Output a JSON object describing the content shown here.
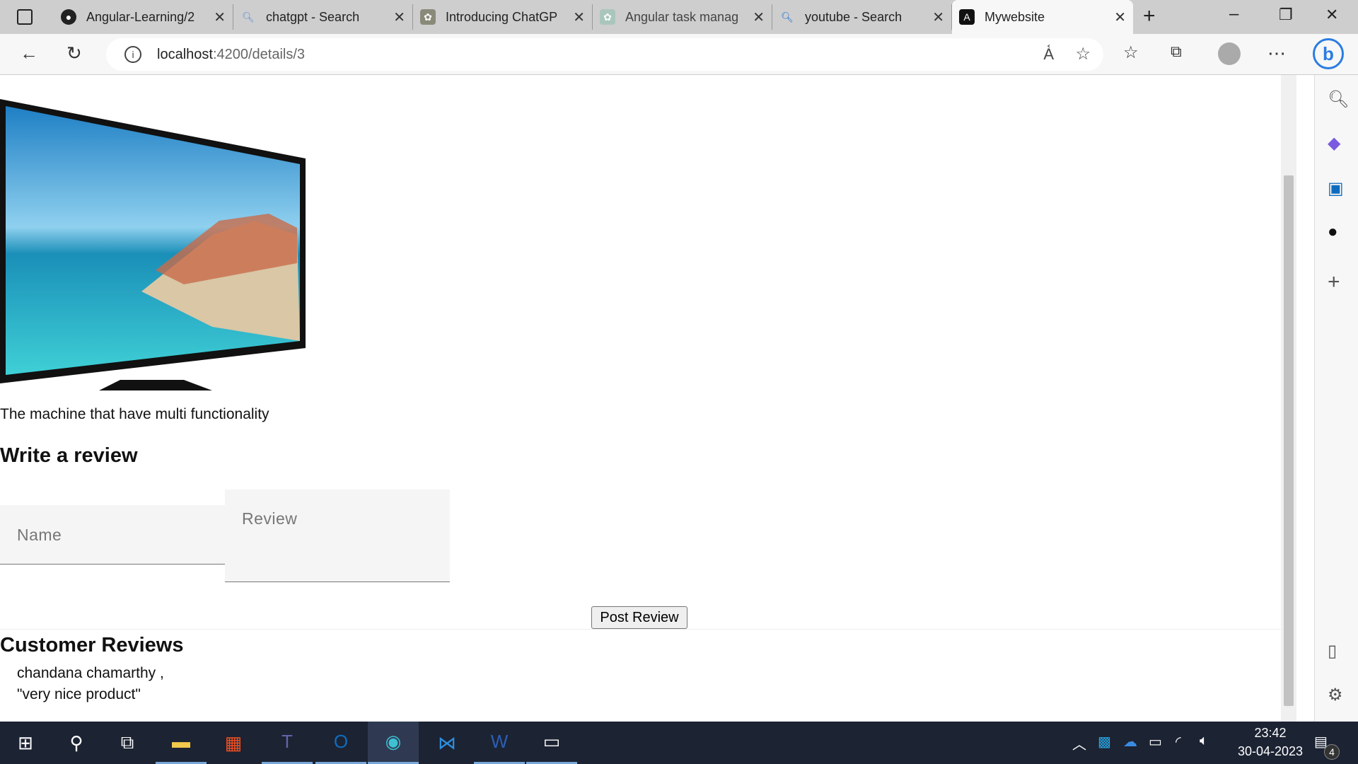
{
  "browser": {
    "tabs": [
      {
        "label": "Angular-Learning/2",
        "icon": "github-icon"
      },
      {
        "label": "chatgpt - Search",
        "icon": "search-icon"
      },
      {
        "label": "Introducing ChatGP",
        "icon": "openai-icon"
      },
      {
        "label": "Angular task manag",
        "icon": "openai-icon"
      },
      {
        "label": "youtube - Search",
        "icon": "search-icon"
      },
      {
        "label": "Mywebsite",
        "icon": "angular-icon",
        "active": true
      }
    ],
    "url_host": "localhost",
    "url_path": ":4200/details/3"
  },
  "page": {
    "description": "The machine that have multi functionality",
    "review_heading": "Write a review",
    "name_placeholder": "Name",
    "review_placeholder": "Review",
    "post_button": "Post Review",
    "reviews_heading": "Customer Reviews",
    "reviews": [
      {
        "name": "chandana chamarthy ,",
        "text": "\"very nice product\""
      }
    ]
  },
  "taskbar": {
    "time": "23:42",
    "date": "30-04-2023",
    "notifications": "4"
  }
}
